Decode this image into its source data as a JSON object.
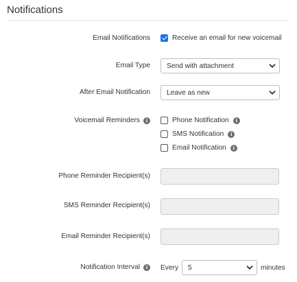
{
  "section": {
    "title": "Notifications"
  },
  "email_notifications": {
    "label": "Email Notifications",
    "checkbox_label": "Receive an email for new voicemail",
    "checked": true
  },
  "email_type": {
    "label": "Email Type",
    "value": "Send with attachment"
  },
  "after_email": {
    "label": "After Email Notification",
    "value": "Leave as new"
  },
  "voicemail_reminders": {
    "label": "Voicemail Reminders",
    "options": [
      {
        "label": "Phone Notification",
        "checked": false
      },
      {
        "label": "SMS Notification",
        "checked": false
      },
      {
        "label": "Email Notification",
        "checked": false
      }
    ]
  },
  "phone_recipients": {
    "label": "Phone Reminder Recipient(s)",
    "value": ""
  },
  "sms_recipients": {
    "label": "SMS Reminder Recipient(s)",
    "value": ""
  },
  "email_recipients": {
    "label": "Email Reminder Recipient(s)",
    "value": ""
  },
  "notification_interval": {
    "label": "Notification Interval",
    "prefix": "Every",
    "value": "5",
    "suffix": "minutes"
  },
  "icons": {
    "info": "info-icon",
    "chevron": "chevron-down-icon",
    "check": "check-icon"
  },
  "colors": {
    "accent": "#1a73e8",
    "disabled_field": "#efefef",
    "border": "#bdbdbd"
  }
}
